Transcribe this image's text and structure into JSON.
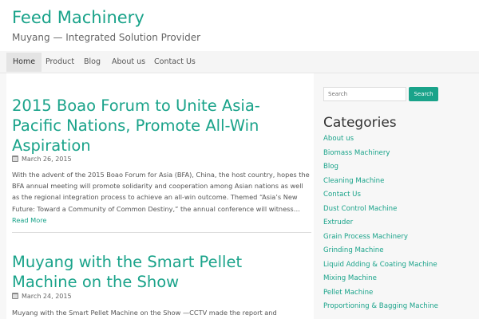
{
  "site": {
    "title": "Feed Machinery",
    "description": "Muyang — Integrated Solution Provider"
  },
  "nav": {
    "items": [
      {
        "label": "Home",
        "active": true
      },
      {
        "label": "Product"
      },
      {
        "label": "Blog"
      },
      {
        "label": "About us"
      },
      {
        "label": "Contact Us"
      }
    ]
  },
  "posts": [
    {
      "title": "2015 Boao Forum to Unite Asia-Pacific Nations, Promote All-Win Aspiration",
      "date": "March 26, 2015",
      "excerpt": "With the advent of the 2015 Boao Forum for Asia (BFA), China, the host country, hopes the BFA annual meeting will promote solidarity and cooperation among Asian nations as well as the regional integration process to achieve an all-win outcome. Themed “Asia’s New Future: Toward a Community of Common Destiny,” the annual conference will witness…",
      "read_more": "Read More"
    },
    {
      "title": "Muyang with the Smart Pellet Machine on the Show",
      "date": "March 24, 2015",
      "excerpt": "Muyang with the Smart Pellet Machine on the Show —CCTV made the report and"
    }
  ],
  "sidebar": {
    "search": {
      "placeholder": "Search",
      "button_label": "Search"
    },
    "categories_heading": "Categories",
    "categories": [
      "About us",
      "Biomass Machinery",
      "Blog",
      "Cleaning Machine",
      "Contact Us",
      "Dust Control Machine",
      "Extruder",
      "Grain Process Machinery",
      "Grinding Machine",
      "Liquid Adding & Coating Machine",
      "Mixing Machine",
      "Pellet Machine",
      "Proportioning & Bagging Machine"
    ]
  },
  "colors": {
    "accent": "#1aa38a",
    "nav_bg": "#f5f5f5",
    "page_bg": "#f7f7f7"
  }
}
